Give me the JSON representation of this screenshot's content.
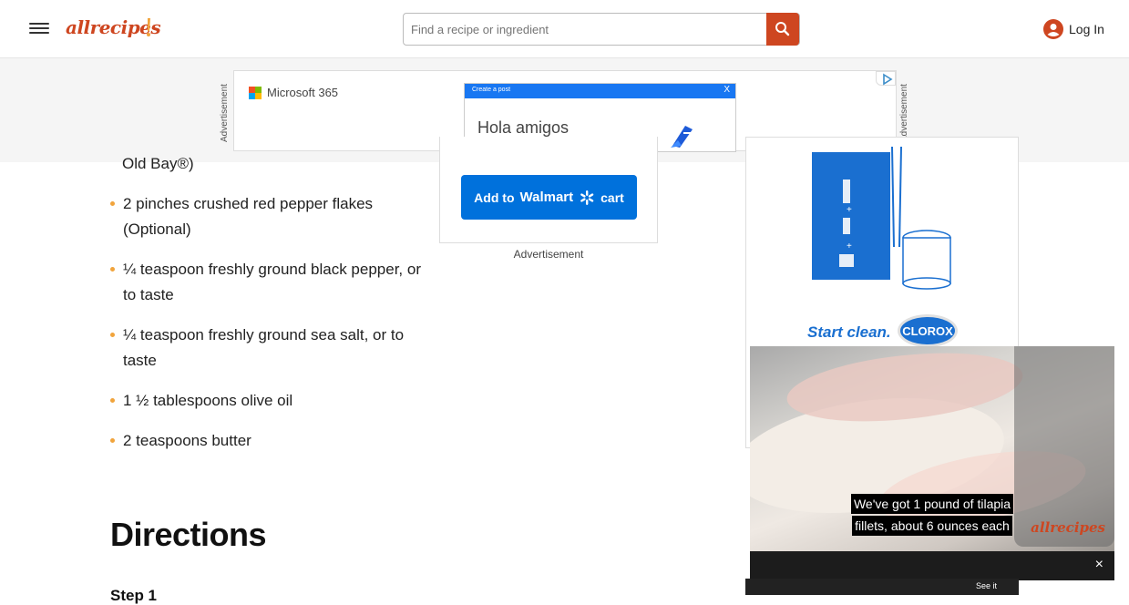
{
  "header": {
    "logo_text": "allrecipes",
    "search_placeholder": "Find a recipe or ingredient",
    "login_label": "Log In"
  },
  "top_ad": {
    "vertical_label": "Advertisement",
    "brand": "Microsoft 365",
    "post_header": "Create a post",
    "post_close": "X",
    "post_text": "Hola amigos"
  },
  "ingredients": {
    "partial_first": "Old Bay®)",
    "items": [
      "2 pinches crushed red pepper flakes (Optional)",
      "¼ teaspoon freshly ground black pepper, or to taste",
      "¼ teaspoon freshly ground sea salt, or to taste",
      "1 ½ tablespoons olive oil",
      "2 teaspoons butter"
    ]
  },
  "walmart": {
    "add_to": "Add to",
    "brand": "Walmart",
    "cart": "cart",
    "ad_label": "Advertisement"
  },
  "right_ad": {
    "tagline": "Start clean.",
    "brand": "CLOROX"
  },
  "directions": {
    "heading": "Directions",
    "step_label": "Step 1"
  },
  "video": {
    "caption_line1": "We've got 1 pound of tilapia",
    "caption_line2": "fillets, about 6 ounces each",
    "watermark": "allrecipes",
    "close": "×"
  },
  "bottom_ad": {
    "text": "See it"
  },
  "colors": {
    "brand": "#ce4620",
    "bullet": "#f1a43c",
    "walmart_blue": "#0071dc",
    "clorox_blue": "#1a6fd0"
  }
}
